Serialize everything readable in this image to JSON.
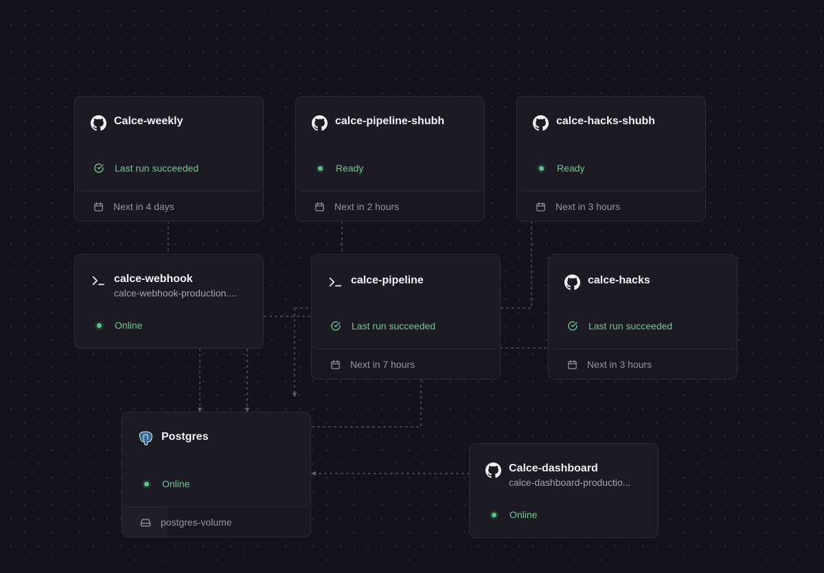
{
  "services": [
    {
      "id": "calce-weekly",
      "icon": "github-icon",
      "title": "Calce-weekly",
      "status": "Last run succeeded",
      "status_icon": "check-circle-icon",
      "footer": "Next in 4 days",
      "footer_icon": "calendar-icon"
    },
    {
      "id": "calce-pipeline-shubh",
      "icon": "github-icon",
      "title": "calce-pipeline-shubh",
      "status": "Ready",
      "status_icon": "status-dot",
      "footer": "Next in 2 hours",
      "footer_icon": "calendar-icon"
    },
    {
      "id": "calce-hacks-shubh",
      "icon": "github-icon",
      "title": "calce-hacks-shubh",
      "status": "Ready",
      "status_icon": "status-dot",
      "footer": "Next in 3 hours",
      "footer_icon": "calendar-icon"
    },
    {
      "id": "calce-webhook",
      "icon": "terminal-icon",
      "title": "calce-webhook",
      "subtitle": "calce-webhook-production....",
      "status": "Online",
      "status_icon": "status-dot"
    },
    {
      "id": "calce-pipeline",
      "icon": "terminal-icon",
      "title": "calce-pipeline",
      "status": "Last run succeeded",
      "status_icon": "check-circle-icon",
      "footer": "Next in 7 hours",
      "footer_icon": "calendar-icon"
    },
    {
      "id": "calce-hacks",
      "icon": "github-icon",
      "title": "calce-hacks",
      "status": "Last run succeeded",
      "status_icon": "check-circle-icon",
      "footer": "Next in 3 hours",
      "footer_icon": "calendar-icon"
    },
    {
      "id": "postgres",
      "icon": "postgres-icon",
      "title": "Postgres",
      "status": "Online",
      "status_icon": "status-dot",
      "footer": "postgres-volume",
      "footer_icon": "volume-icon"
    },
    {
      "id": "calce-dashboard",
      "icon": "github-icon",
      "title": "Calce-dashboard",
      "subtitle": "calce-dashboard-productio...",
      "status": "Online",
      "status_icon": "status-dot"
    }
  ],
  "colors": {
    "canvas": "#14131a",
    "card": "#1c1b23",
    "border": "#2e2d36",
    "status_green": "#73c795",
    "connector": "#5d5b66"
  }
}
